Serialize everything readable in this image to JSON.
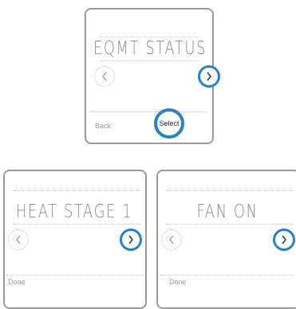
{
  "screens": {
    "top": {
      "display_text": "EQMT STATUS",
      "left_softkey": "Back",
      "center_button": "Select"
    },
    "left": {
      "display_text": "HEAT STAGE 1",
      "left_softkey": "Done"
    },
    "right": {
      "display_text": "FAN ON",
      "left_softkey": "Done"
    }
  },
  "icons": {
    "prev": "chevron-left-icon",
    "next": "chevron-right-icon"
  },
  "colors": {
    "highlight": "#2a80c2",
    "bezel": "#9a9a9a",
    "segment_text": "#8a8a8a"
  }
}
